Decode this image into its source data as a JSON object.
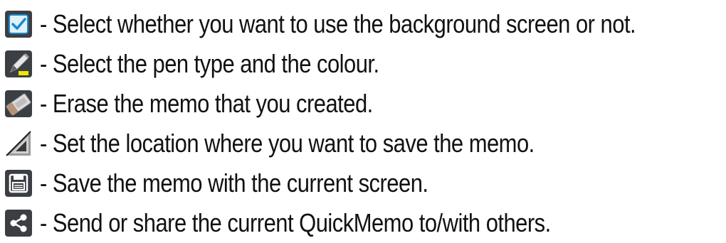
{
  "items": [
    {
      "icon": "background-toggle-icon",
      "text": "- Select whether you want to use the background screen or not."
    },
    {
      "icon": "pen-icon",
      "text": "- Select the pen type and the colour."
    },
    {
      "icon": "eraser-icon",
      "text": "- Erase the memo that you created."
    },
    {
      "icon": "crop-location-icon",
      "text": "- Set the location where you want to save the memo."
    },
    {
      "icon": "save-icon",
      "text": "- Save the memo with the current screen."
    },
    {
      "icon": "share-icon",
      "text": "- Send or share the current QuickMemo to/with others."
    }
  ]
}
